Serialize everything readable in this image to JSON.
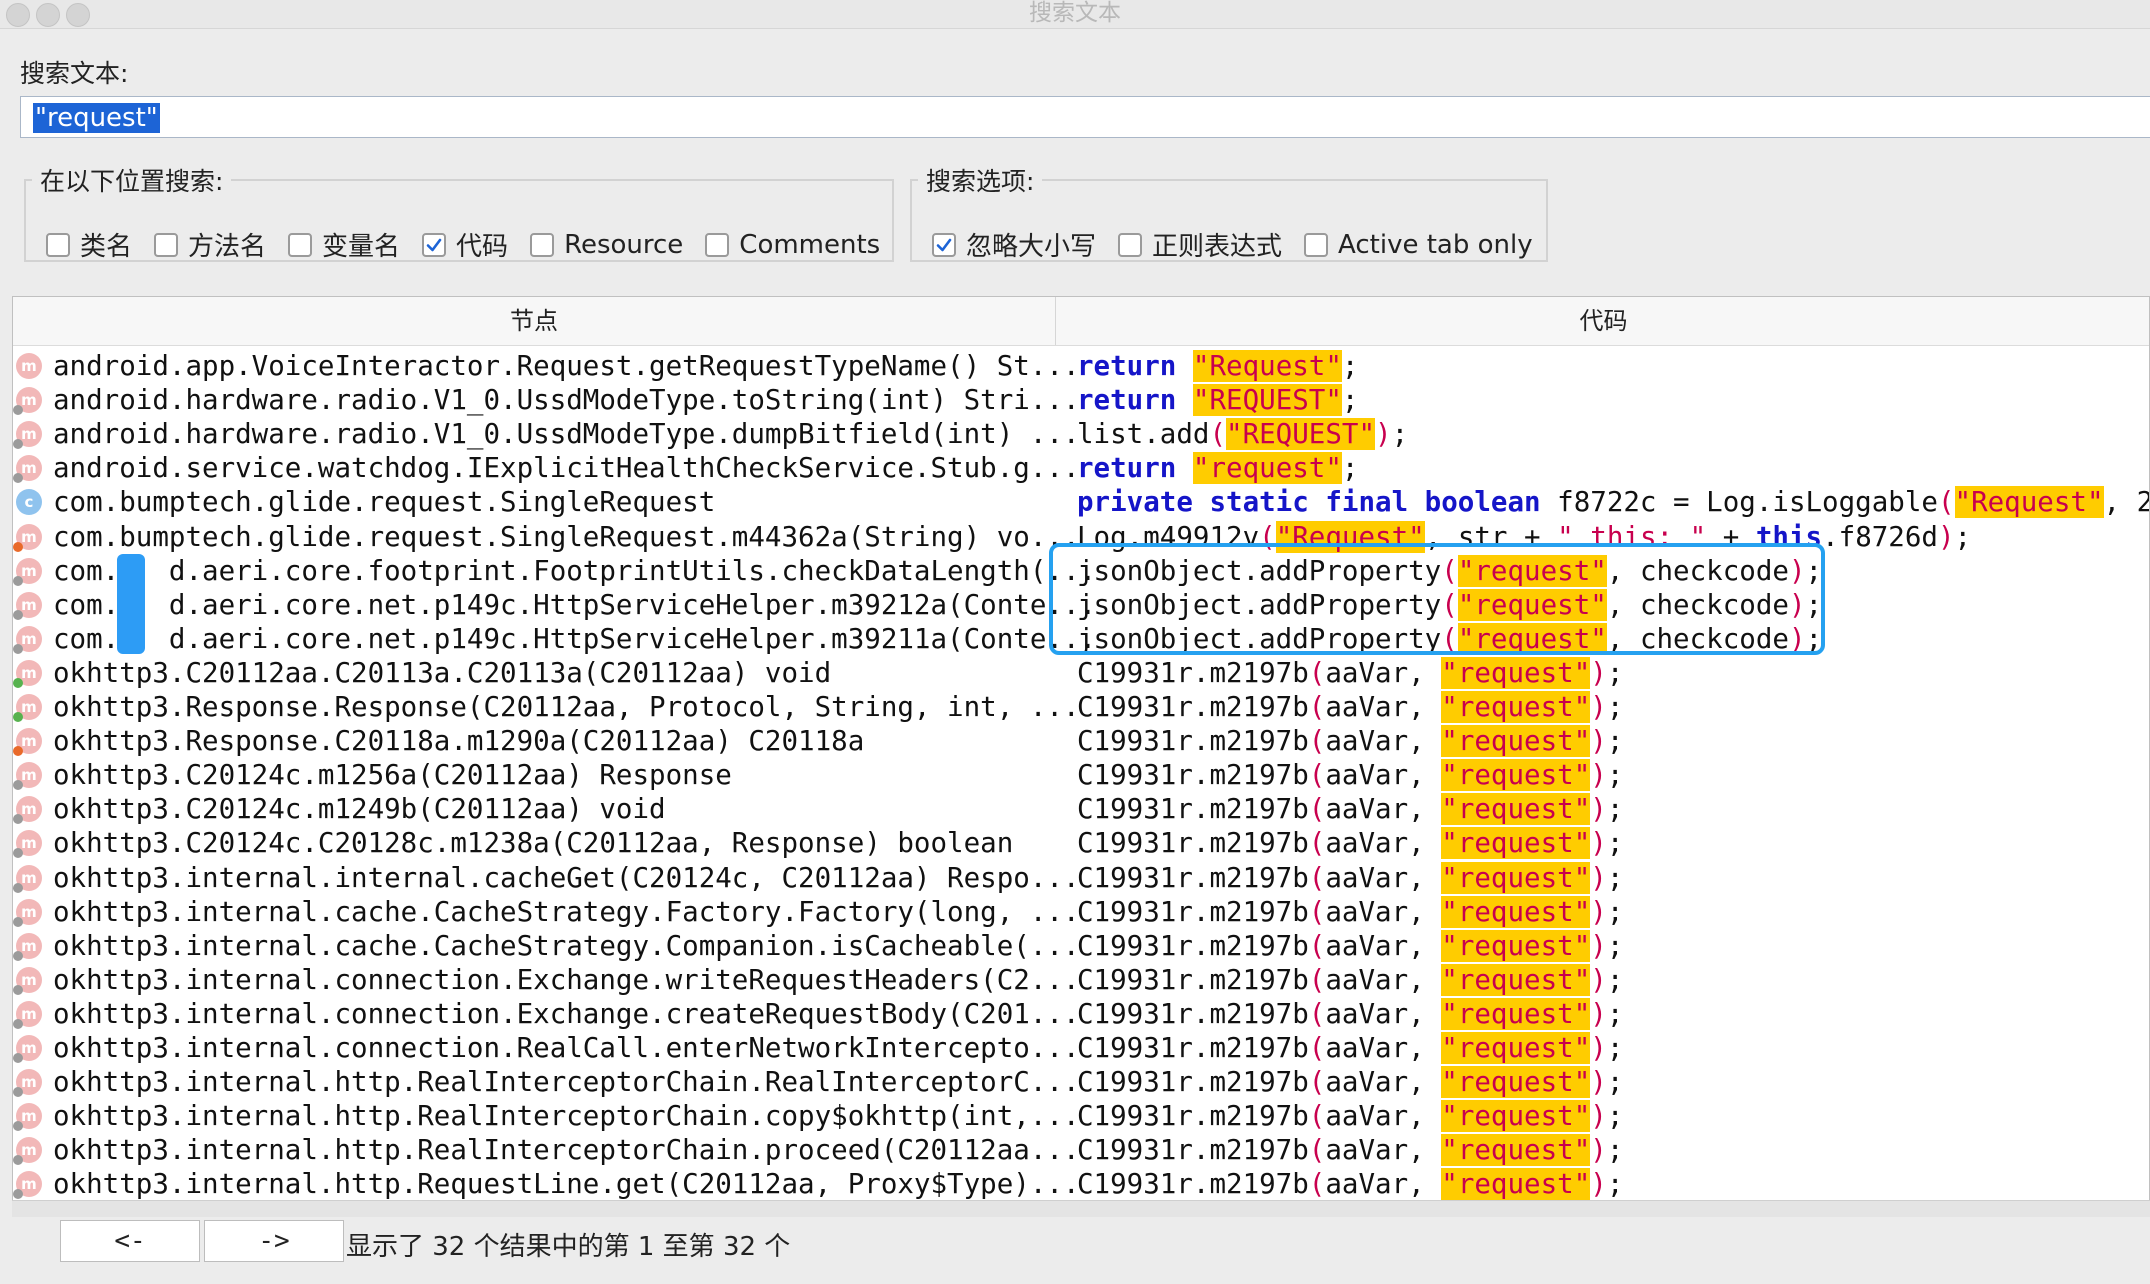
{
  "window": {
    "title": "搜索文本"
  },
  "search": {
    "label": "搜索文本:",
    "value": "\"request\""
  },
  "location_group": {
    "legend": "在以下位置搜索:",
    "options": [
      {
        "label": "类名",
        "checked": false
      },
      {
        "label": "方法名",
        "checked": false
      },
      {
        "label": "变量名",
        "checked": false
      },
      {
        "label": "代码",
        "checked": true
      },
      {
        "label": "Resource",
        "checked": false
      },
      {
        "label": "Comments",
        "checked": false
      }
    ]
  },
  "options_group": {
    "legend": "搜索选项:",
    "options": [
      {
        "label": "忽略大小写",
        "checked": true
      },
      {
        "label": "正则表达式",
        "checked": false
      },
      {
        "label": "Active tab only",
        "checked": false
      }
    ]
  },
  "table": {
    "columns": [
      "节点",
      "代码"
    ],
    "rows": [
      {
        "icon": "method",
        "badge": "none",
        "node": "android.app.VoiceInteractor.Request.getRequestTypeName() St...",
        "code": [
          [
            "kw",
            "return"
          ],
          [
            "t",
            " "
          ],
          [
            "str",
            "\"Request\""
          ],
          [
            "t",
            ";"
          ]
        ]
      },
      {
        "icon": "method",
        "badge": "gray",
        "node": "android.hardware.radio.V1_0.UssdModeType.toString(int) Stri...",
        "code": [
          [
            "kw",
            "return"
          ],
          [
            "t",
            " "
          ],
          [
            "str",
            "\"REQUEST\""
          ],
          [
            "t",
            ";"
          ]
        ]
      },
      {
        "icon": "method",
        "badge": "gray",
        "node": "android.hardware.radio.V1_0.UssdModeType.dumpBitfield(int) ...",
        "code": [
          [
            "t",
            "list.add"
          ],
          [
            "pun",
            "("
          ],
          [
            "str",
            "\"REQUEST\""
          ],
          [
            "pun",
            ")"
          ],
          [
            "t",
            ";"
          ]
        ]
      },
      {
        "icon": "method",
        "badge": "gray",
        "node": "android.service.watchdog.IExplicitHealthCheckService.Stub.g...",
        "code": [
          [
            "kw",
            "return"
          ],
          [
            "t",
            " "
          ],
          [
            "str",
            "\"request\""
          ],
          [
            "t",
            ";"
          ]
        ]
      },
      {
        "icon": "class",
        "badge": "none",
        "node": "com.bumptech.glide.request.SingleRequest",
        "code": [
          [
            "kw",
            "private static final boolean"
          ],
          [
            "t",
            " f8722c = Log.isLoggable"
          ],
          [
            "pun",
            "("
          ],
          [
            "str",
            "\"Request\""
          ],
          [
            "t",
            ", 2"
          ],
          [
            "pun",
            ")"
          ],
          [
            "t",
            ";"
          ]
        ]
      },
      {
        "icon": "method",
        "badge": "orange",
        "node": "com.bumptech.glide.request.SingleRequest.m44362a(String) vo...",
        "code": [
          [
            "t",
            "Log.m49912v"
          ],
          [
            "pun",
            "("
          ],
          [
            "str",
            "\"Request\""
          ],
          [
            "t",
            ", str + "
          ],
          [
            "pun",
            "\" this: \""
          ],
          [
            "t",
            " + "
          ],
          [
            "kw",
            "this"
          ],
          [
            "t",
            ".f8726d"
          ],
          [
            "pun",
            ")"
          ],
          [
            "t",
            ";"
          ]
        ]
      },
      {
        "icon": "method",
        "badge": "gray",
        "node": "com.   d.aeri.core.footprint.FootprintUtils.checkDataLength(...",
        "code": [
          [
            "t",
            "jsonObject.addProperty"
          ],
          [
            "pun",
            "("
          ],
          [
            "str",
            "\"request\""
          ],
          [
            "t",
            ", checkcode"
          ],
          [
            "pun",
            ")"
          ],
          [
            "t",
            ";"
          ]
        ]
      },
      {
        "icon": "method",
        "badge": "gray",
        "node": "com.   d.aeri.core.net.p149c.HttpServiceHelper.m39212a(Conte...",
        "code": [
          [
            "t",
            "jsonObject.addProperty"
          ],
          [
            "pun",
            "("
          ],
          [
            "str",
            "\"request\""
          ],
          [
            "t",
            ", checkcode"
          ],
          [
            "pun",
            ")"
          ],
          [
            "t",
            ";"
          ]
        ]
      },
      {
        "icon": "method",
        "badge": "gray",
        "node": "com.   d.aeri.core.net.p149c.HttpServiceHelper.m39211a(Conte...",
        "code": [
          [
            "t",
            "jsonObject.addProperty"
          ],
          [
            "pun",
            "("
          ],
          [
            "str",
            "\"request\""
          ],
          [
            "t",
            ", checkcode"
          ],
          [
            "pun",
            ")"
          ],
          [
            "t",
            ";"
          ]
        ]
      },
      {
        "icon": "method",
        "badge": "green",
        "node": "okhttp3.C20112aa.C20113a.C20113a(C20112aa) void",
        "code": [
          [
            "t",
            "C19931r.m2197b"
          ],
          [
            "pun",
            "("
          ],
          [
            "t",
            "aaVar, "
          ],
          [
            "str",
            "\"request\""
          ],
          [
            "pun",
            ")"
          ],
          [
            "t",
            ";"
          ]
        ]
      },
      {
        "icon": "method",
        "badge": "green",
        "node": "okhttp3.Response.Response(C20112aa, Protocol, String, int, ...",
        "code": [
          [
            "t",
            "C19931r.m2197b"
          ],
          [
            "pun",
            "("
          ],
          [
            "t",
            "aaVar, "
          ],
          [
            "str",
            "\"request\""
          ],
          [
            "pun",
            ")"
          ],
          [
            "t",
            ";"
          ]
        ]
      },
      {
        "icon": "method",
        "badge": "orange",
        "node": "okhttp3.Response.C20118a.m1290a(C20112aa) C20118a",
        "code": [
          [
            "t",
            "C19931r.m2197b"
          ],
          [
            "pun",
            "("
          ],
          [
            "t",
            "aaVar, "
          ],
          [
            "str",
            "\"request\""
          ],
          [
            "pun",
            ")"
          ],
          [
            "t",
            ";"
          ]
        ]
      },
      {
        "icon": "method",
        "badge": "gray",
        "node": "okhttp3.C20124c.m1256a(C20112aa) Response",
        "code": [
          [
            "t",
            "C19931r.m2197b"
          ],
          [
            "pun",
            "("
          ],
          [
            "t",
            "aaVar, "
          ],
          [
            "str",
            "\"request\""
          ],
          [
            "pun",
            ")"
          ],
          [
            "t",
            ";"
          ]
        ]
      },
      {
        "icon": "method",
        "badge": "gray",
        "node": "okhttp3.C20124c.m1249b(C20112aa) void",
        "code": [
          [
            "t",
            "C19931r.m2197b"
          ],
          [
            "pun",
            "("
          ],
          [
            "t",
            "aaVar, "
          ],
          [
            "str",
            "\"request\""
          ],
          [
            "pun",
            ")"
          ],
          [
            "t",
            ";"
          ]
        ]
      },
      {
        "icon": "method",
        "badge": "gray",
        "node": "okhttp3.C20124c.C20128c.m1238a(C20112aa, Response) boolean",
        "code": [
          [
            "t",
            "C19931r.m2197b"
          ],
          [
            "pun",
            "("
          ],
          [
            "t",
            "aaVar, "
          ],
          [
            "str",
            "\"request\""
          ],
          [
            "pun",
            ")"
          ],
          [
            "t",
            ";"
          ]
        ]
      },
      {
        "icon": "method",
        "badge": "gray",
        "node": "okhttp3.internal.internal.cacheGet(C20124c, C20112aa) Respo...",
        "code": [
          [
            "t",
            "C19931r.m2197b"
          ],
          [
            "pun",
            "("
          ],
          [
            "t",
            "aaVar, "
          ],
          [
            "str",
            "\"request\""
          ],
          [
            "pun",
            ")"
          ],
          [
            "t",
            ";"
          ]
        ]
      },
      {
        "icon": "method",
        "badge": "gray",
        "node": "okhttp3.internal.cache.CacheStrategy.Factory.Factory(long, ...",
        "code": [
          [
            "t",
            "C19931r.m2197b"
          ],
          [
            "pun",
            "("
          ],
          [
            "t",
            "aaVar, "
          ],
          [
            "str",
            "\"request\""
          ],
          [
            "pun",
            ")"
          ],
          [
            "t",
            ";"
          ]
        ]
      },
      {
        "icon": "method",
        "badge": "gray",
        "node": "okhttp3.internal.cache.CacheStrategy.Companion.isCacheable(...",
        "code": [
          [
            "t",
            "C19931r.m2197b"
          ],
          [
            "pun",
            "("
          ],
          [
            "t",
            "aaVar, "
          ],
          [
            "str",
            "\"request\""
          ],
          [
            "pun",
            ")"
          ],
          [
            "t",
            ";"
          ]
        ]
      },
      {
        "icon": "method",
        "badge": "gray",
        "node": "okhttp3.internal.connection.Exchange.writeRequestHeaders(C2...",
        "code": [
          [
            "t",
            "C19931r.m2197b"
          ],
          [
            "pun",
            "("
          ],
          [
            "t",
            "aaVar, "
          ],
          [
            "str",
            "\"request\""
          ],
          [
            "pun",
            ")"
          ],
          [
            "t",
            ";"
          ]
        ]
      },
      {
        "icon": "method",
        "badge": "gray",
        "node": "okhttp3.internal.connection.Exchange.createRequestBody(C201...",
        "code": [
          [
            "t",
            "C19931r.m2197b"
          ],
          [
            "pun",
            "("
          ],
          [
            "t",
            "aaVar, "
          ],
          [
            "str",
            "\"request\""
          ],
          [
            "pun",
            ")"
          ],
          [
            "t",
            ";"
          ]
        ]
      },
      {
        "icon": "method",
        "badge": "gray",
        "node": "okhttp3.internal.connection.RealCall.enterNetworkIntercepto...",
        "code": [
          [
            "t",
            "C19931r.m2197b"
          ],
          [
            "pun",
            "("
          ],
          [
            "t",
            "aaVar, "
          ],
          [
            "str",
            "\"request\""
          ],
          [
            "pun",
            ")"
          ],
          [
            "t",
            ";"
          ]
        ]
      },
      {
        "icon": "method",
        "badge": "gray",
        "node": "okhttp3.internal.http.RealInterceptorChain.RealInterceptorC...",
        "code": [
          [
            "t",
            "C19931r.m2197b"
          ],
          [
            "pun",
            "("
          ],
          [
            "t",
            "aaVar, "
          ],
          [
            "str",
            "\"request\""
          ],
          [
            "pun",
            ")"
          ],
          [
            "t",
            ";"
          ]
        ]
      },
      {
        "icon": "method",
        "badge": "gray",
        "node": "okhttp3.internal.http.RealInterceptorChain.copy$okhttp(int,...",
        "code": [
          [
            "t",
            "C19931r.m2197b"
          ],
          [
            "pun",
            "("
          ],
          [
            "t",
            "aaVar, "
          ],
          [
            "str",
            "\"request\""
          ],
          [
            "pun",
            ")"
          ],
          [
            "t",
            ";"
          ]
        ]
      },
      {
        "icon": "method",
        "badge": "gray",
        "node": "okhttp3.internal.http.RealInterceptorChain.proceed(C20112aa...",
        "code": [
          [
            "t",
            "C19931r.m2197b"
          ],
          [
            "pun",
            "("
          ],
          [
            "t",
            "aaVar, "
          ],
          [
            "str",
            "\"request\""
          ],
          [
            "pun",
            ")"
          ],
          [
            "t",
            ";"
          ]
        ]
      },
      {
        "icon": "method",
        "badge": "gray",
        "node": "okhttp3.internal.http.RequestLine.get(C20112aa, Proxy$Type)...",
        "code": [
          [
            "t",
            "C19931r.m2197b"
          ],
          [
            "pun",
            "("
          ],
          [
            "t",
            "aaVar, "
          ],
          [
            "str",
            "\"request\""
          ],
          [
            "pun",
            ")"
          ],
          [
            "t",
            ";"
          ]
        ]
      }
    ]
  },
  "footer": {
    "prev_label": "<-",
    "next_label": "->",
    "status": "显示了 32 个结果中的第 1 至第 32 个"
  },
  "colors": {
    "keyword": "#1515c8",
    "string_bg": "#ffcc00",
    "string_fg": "#c8004e",
    "selection": "#1d64d6",
    "highlight_box": "#25a1f0"
  },
  "icons": {
    "method": "m",
    "class": "c"
  }
}
